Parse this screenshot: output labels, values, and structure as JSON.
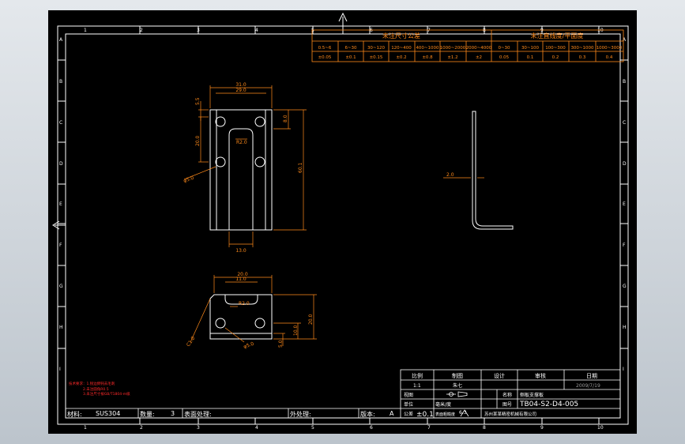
{
  "border": {
    "col_labels": [
      "1",
      "2",
      "3",
      "4",
      "5",
      "6",
      "7",
      "8",
      "9",
      "10"
    ],
    "row_labels": [
      "A",
      "B",
      "C",
      "D",
      "E",
      "F",
      "G",
      "H",
      "I"
    ]
  },
  "tolerance_table": {
    "left_title": "未注尺寸公差",
    "right_title": "未注直线度/平面度",
    "ranges_left": [
      "0.5~6",
      "6~30",
      "30~120",
      "120~400",
      "400~1000",
      "1000~2000",
      "2000~4000"
    ],
    "values_left": [
      "±0.05",
      "±0.1",
      "±0.15",
      "±0.2",
      "±0.8",
      "±1.2",
      "±2"
    ],
    "ranges_right": [
      "0~30",
      "30~100",
      "100~300",
      "300~1000",
      "1000~3000"
    ],
    "values_right": [
      "0.05",
      "0.1",
      "0.2",
      "0.3",
      "0.4"
    ]
  },
  "dimensions": {
    "front_top_outer": "31.0",
    "front_top_inner": "29.0",
    "front_left_small": "5.5",
    "front_left_mid": "20.0",
    "front_right_small": "8.0",
    "front_right_total": "60.1",
    "front_bottom": "13.0",
    "front_radius": "R2.0",
    "front_hole": "φ5.0",
    "side_thickness": "2.0",
    "bottom_top_outer": "20.0",
    "bottom_top_inner": "11.0",
    "bottom_radius": "R2.0",
    "bottom_chamfer": "C1.0",
    "bottom_hole": "φ5.0",
    "bottom_right_a": "10.0",
    "bottom_right_b": "20.0",
    "bottom_right_small": "5.0"
  },
  "notes": [
    "技术要求：1.锐边倒钝去毛刺",
    "2.未注圆角R0.5",
    "3.未注尺寸按GB/T1804-m级"
  ],
  "title_block": {
    "header": [
      "比例",
      "制图",
      "设计",
      "审核",
      "日期"
    ],
    "scale": "1:1",
    "drafter": "朱七",
    "date": "2009/7/19",
    "projection_label": "视图",
    "name_label": "名称",
    "name_value": "侧板支撑板",
    "tolerance_label": "公差",
    "tolerance_value": "±0.1",
    "unit_label": "单位",
    "unit_value": "毫米/度",
    "roughness_label": "表面粗糙度",
    "roughness_value": "6.3",
    "drawing_no_label": "图号",
    "drawing_no_value": "TB04-S2-D4-005",
    "company": "苏州某某精密机械有限公司",
    "material_label": "材料:",
    "material_value": "SUS304",
    "qty_label": "数量:",
    "qty_value": "3",
    "surface_label": "表面处理:",
    "surface_value": "",
    "spare_label": "外处理:",
    "rev_label": "版本:",
    "rev_value": "A"
  }
}
